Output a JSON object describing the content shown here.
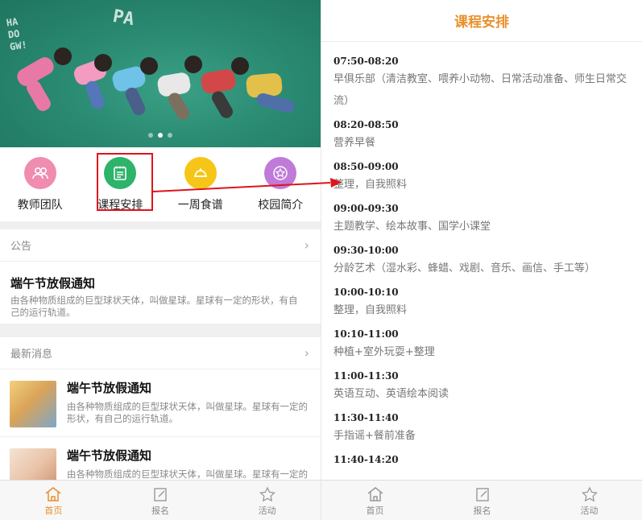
{
  "left": {
    "banner": {
      "chalk_text_1": "HA\nDO\nGW!",
      "chalk_text_2": "PA"
    },
    "quick": [
      {
        "label": "教师团队",
        "icon": "teachers-icon",
        "color": "#f08cb0"
      },
      {
        "label": "课程安排",
        "icon": "schedule-icon",
        "color": "#2db36a"
      },
      {
        "label": "一周食谱",
        "icon": "dish-icon",
        "color": "#f5c518"
      },
      {
        "label": "校园简介",
        "icon": "star-badge-icon",
        "color": "#c07ad8"
      }
    ],
    "notice": {
      "header": "公告",
      "title": "端午节放假通知",
      "desc": "由各种物质组成的巨型球状天体，叫做星球。星球有一定的形状，有自己的运行轨道。"
    },
    "news": {
      "header": "最新消息",
      "items": [
        {
          "title": "端午节放假通知",
          "desc": "由各种物质组成的巨型球状天体，叫做星球。星球有一定的形状，有自己的运行轨道。"
        },
        {
          "title": "端午节放假通知",
          "desc": "由各种物质组成的巨型球状天体，叫做星球。星球有一定的形状，有自己的运行轨道。"
        }
      ]
    }
  },
  "tabbar": [
    {
      "label": "首页",
      "icon": "home-icon"
    },
    {
      "label": "报名",
      "icon": "signup-icon"
    },
    {
      "label": "活动",
      "icon": "star-icon"
    }
  ],
  "right": {
    "title": "课程安排",
    "schedule": [
      {
        "time": "07:50-08:20",
        "activity": "早俱乐部（清洁教室、喂养小动物、日常活动准备、师生日常交流）"
      },
      {
        "time": "08:20-08:50",
        "activity": "营养早餐"
      },
      {
        "time": "08:50-09:00",
        "activity": "整理，自我照料"
      },
      {
        "time": "09:00-09:30",
        "activity": "主题教学、绘本故事、国学小课堂"
      },
      {
        "time": "09:30-10:00",
        "activity": "分龄艺术（湿水彩、蜂蜡、戏剧、音乐、画信、手工等）"
      },
      {
        "time": "10:00-10:10",
        "activity": "整理，自我照料"
      },
      {
        "time": "10:10-11:00",
        "activity": "种植+室外玩耍+整理"
      },
      {
        "time": "11:00-11:30",
        "activity": "英语互动、英语绘本阅读"
      },
      {
        "time": "11:30-11:40",
        "activity": "手指谣+餐前准备"
      },
      {
        "time": "11:40-14:20",
        "activity": ""
      }
    ]
  },
  "colors": {
    "accent": "#e8902c",
    "highlight": "#e0141a"
  }
}
